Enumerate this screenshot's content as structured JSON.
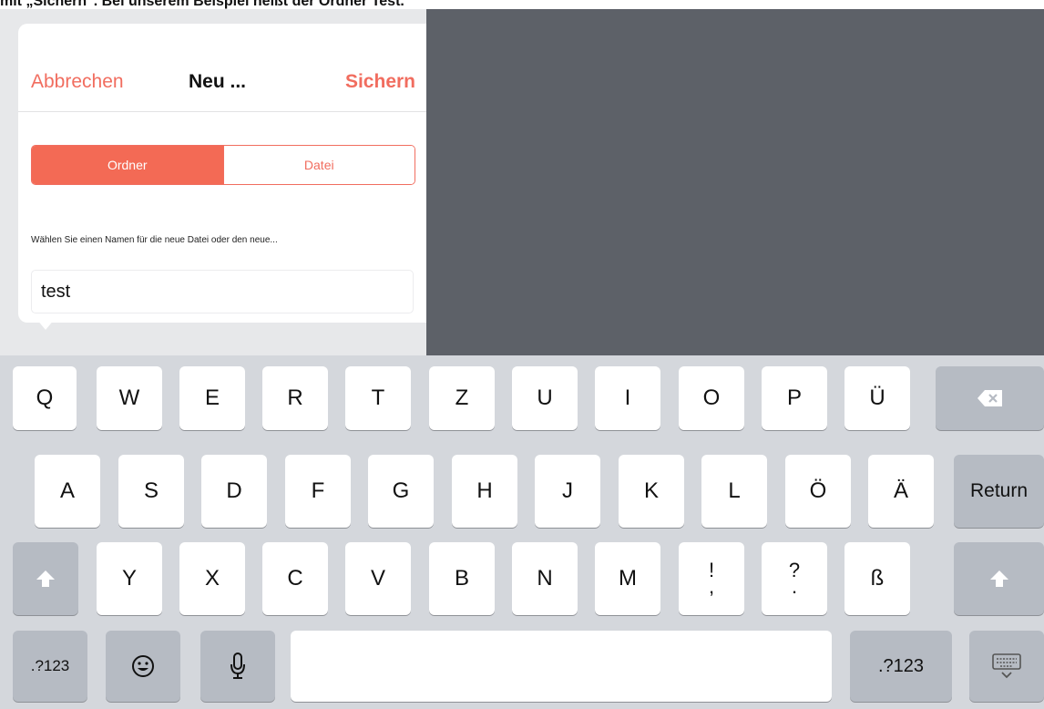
{
  "caption": "mit „Sichern\". Bei unserem Beispiel heißt der Ordner Test.",
  "popover": {
    "cancel": "Abbrechen",
    "title": "Neu ...",
    "save": "Sichern",
    "segments": [
      "Ordner",
      "Datei"
    ],
    "selected_segment": "Ordner",
    "hint": "Wählen Sie einen Namen für die neue Datei oder den neue...",
    "input_value": "test"
  },
  "keyboard": {
    "row1": [
      "Q",
      "W",
      "E",
      "R",
      "T",
      "Z",
      "U",
      "I",
      "O",
      "P",
      "Ü"
    ],
    "row2": [
      "A",
      "S",
      "D",
      "F",
      "G",
      "H",
      "J",
      "K",
      "L",
      "Ö",
      "Ä"
    ],
    "row3": [
      "Y",
      "X",
      "C",
      "V",
      "B",
      "N",
      "M"
    ],
    "punct1_top": "!",
    "punct1_bottom": ",",
    "punct2_top": "?",
    "punct2_bottom": ".",
    "eszett": "ß",
    "return": "Return",
    "numbers_left": ".?123",
    "numbers_right": ".?123"
  },
  "colors": {
    "accent": "#f16d5f",
    "dark_panel": "#5d6168",
    "keyboard_bg": "#d4d7dc"
  }
}
